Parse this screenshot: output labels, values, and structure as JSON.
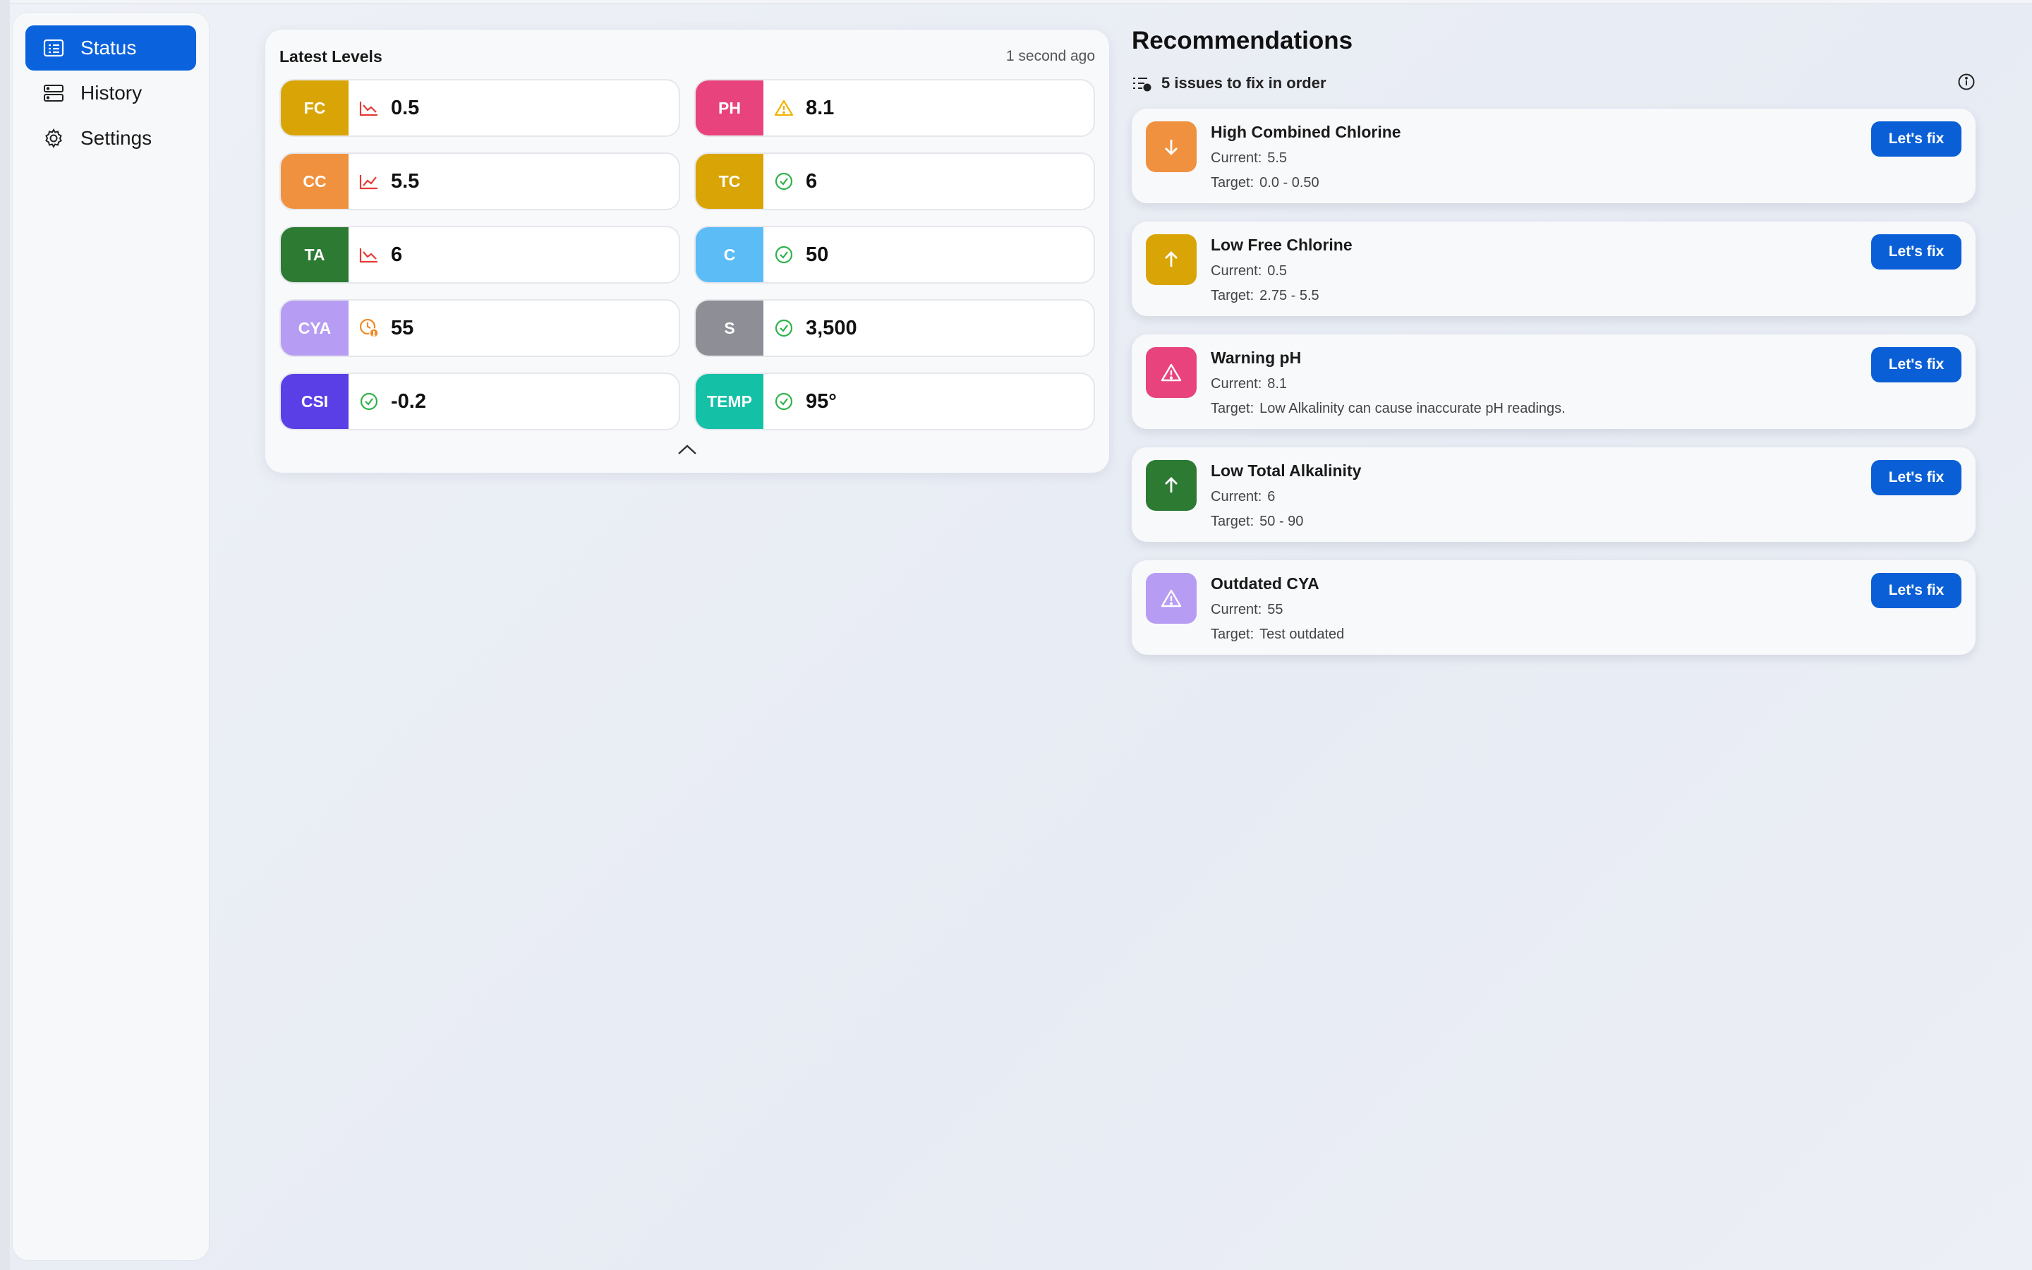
{
  "sidebar": {
    "items": [
      {
        "label": "Status",
        "icon": "status-list-icon",
        "active": true
      },
      {
        "label": "History",
        "icon": "history-icon",
        "active": false
      },
      {
        "label": "Settings",
        "icon": "gear-icon",
        "active": false
      }
    ]
  },
  "levels": {
    "title": "Latest Levels",
    "updated": "1 second ago",
    "items": [
      {
        "tag": "FC",
        "value": "0.5",
        "color": "#d9a406",
        "status": "trend-down-icon"
      },
      {
        "tag": "PH",
        "value": "8.1",
        "color": "#e8437c",
        "status": "warning-icon"
      },
      {
        "tag": "CC",
        "value": "5.5",
        "color": "#f0913f",
        "status": "trend-up-icon"
      },
      {
        "tag": "TC",
        "value": "6",
        "color": "#d9a406",
        "status": "check-icon"
      },
      {
        "tag": "TA",
        "value": "6",
        "color": "#2d7a33",
        "status": "trend-down-icon"
      },
      {
        "tag": "C",
        "value": "50",
        "color": "#5bbcf6",
        "status": "check-icon"
      },
      {
        "tag": "CYA",
        "value": "55",
        "color": "#b69cf2",
        "status": "outdated-clock-icon"
      },
      {
        "tag": "S",
        "value": "3,500",
        "color": "#8e8e96",
        "status": "check-icon"
      },
      {
        "tag": "CSI",
        "value": "-0.2",
        "color": "#5b3fe6",
        "status": "check-icon"
      },
      {
        "tag": "TEMP",
        "value": "95°",
        "color": "#14c0a6",
        "status": "check-icon"
      }
    ]
  },
  "recommendations": {
    "title": "Recommendations",
    "summary": "5 issues to fix in order",
    "current_label": "Current:",
    "target_label": "Target:",
    "items": [
      {
        "name": "High Combined Chlorine",
        "current": "5.5",
        "target": "0.0 - 0.50",
        "color": "#f0913f",
        "icon": "arrow-down-icon",
        "button": "Let's fix"
      },
      {
        "name": "Low Free Chlorine",
        "current": "0.5",
        "target": "2.75 - 5.5",
        "color": "#d9a406",
        "icon": "arrow-up-icon",
        "button": "Let's fix"
      },
      {
        "name": "Warning pH",
        "current": "8.1",
        "target": "Low Alkalinity can cause inaccurate pH readings.",
        "color": "#e8437c",
        "icon": "warning-icon",
        "button": "Let's fix"
      },
      {
        "name": "Low Total Alkalinity",
        "current": "6",
        "target": "50 - 90",
        "color": "#2d7a33",
        "icon": "arrow-up-icon",
        "button": "Let's fix"
      },
      {
        "name": "Outdated CYA",
        "current": "55",
        "target": "Test outdated",
        "color": "#b69cf2",
        "icon": "warning-icon",
        "button": "Let's fix"
      }
    ]
  }
}
